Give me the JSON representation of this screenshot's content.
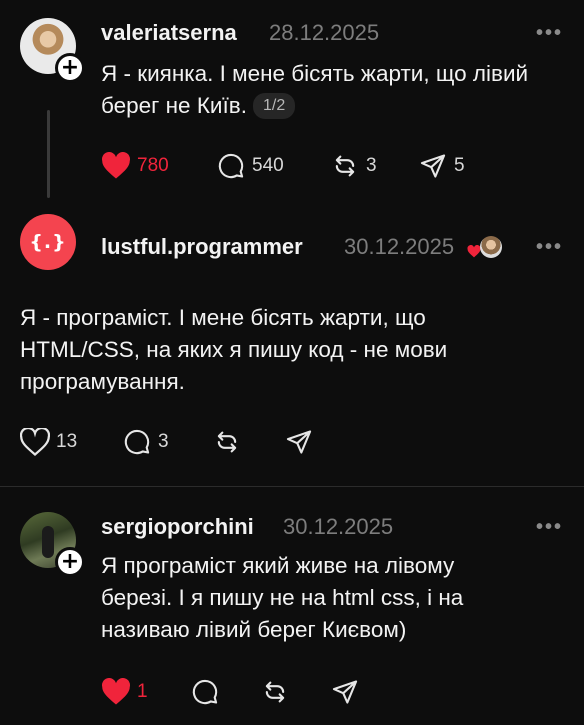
{
  "posts": [
    {
      "username": "valeriatserna",
      "date": "28.12.2025",
      "more": "•••",
      "text": "Я - киянка. І мене бісять жарти, що лівий берег не Київ.",
      "badge": "1/2",
      "likes": "780",
      "comments": "540",
      "reposts": "3",
      "shares": "5",
      "liked": true
    },
    {
      "username": "lustful.programmer",
      "date": "30.12.2025",
      "avatar_text": "{.}",
      "more": "•••",
      "text_lines": [
        "Я - програміст. І мене бісять жарти, що",
        "HTML/CSS, на яких я пишу код - не мови",
        "програмування."
      ],
      "likes": "13",
      "comments": "3",
      "liked": false
    },
    {
      "username": "sergioporchini",
      "date": "30.12.2025",
      "more": "•••",
      "text_lines": [
        "Я програміст який живе на лівому",
        "березі. І я пишу не на html css, і на",
        "називаю лівий берег Києвом)"
      ],
      "likes": "1",
      "liked": true
    }
  ],
  "colors": {
    "background": "#0d0d0d",
    "like_red": "#f0243b",
    "avatar_red": "#f4444f"
  },
  "icons": [
    "heart-icon",
    "comment-icon",
    "repost-icon",
    "share-icon",
    "follow-plus-icon",
    "more-icon"
  ]
}
